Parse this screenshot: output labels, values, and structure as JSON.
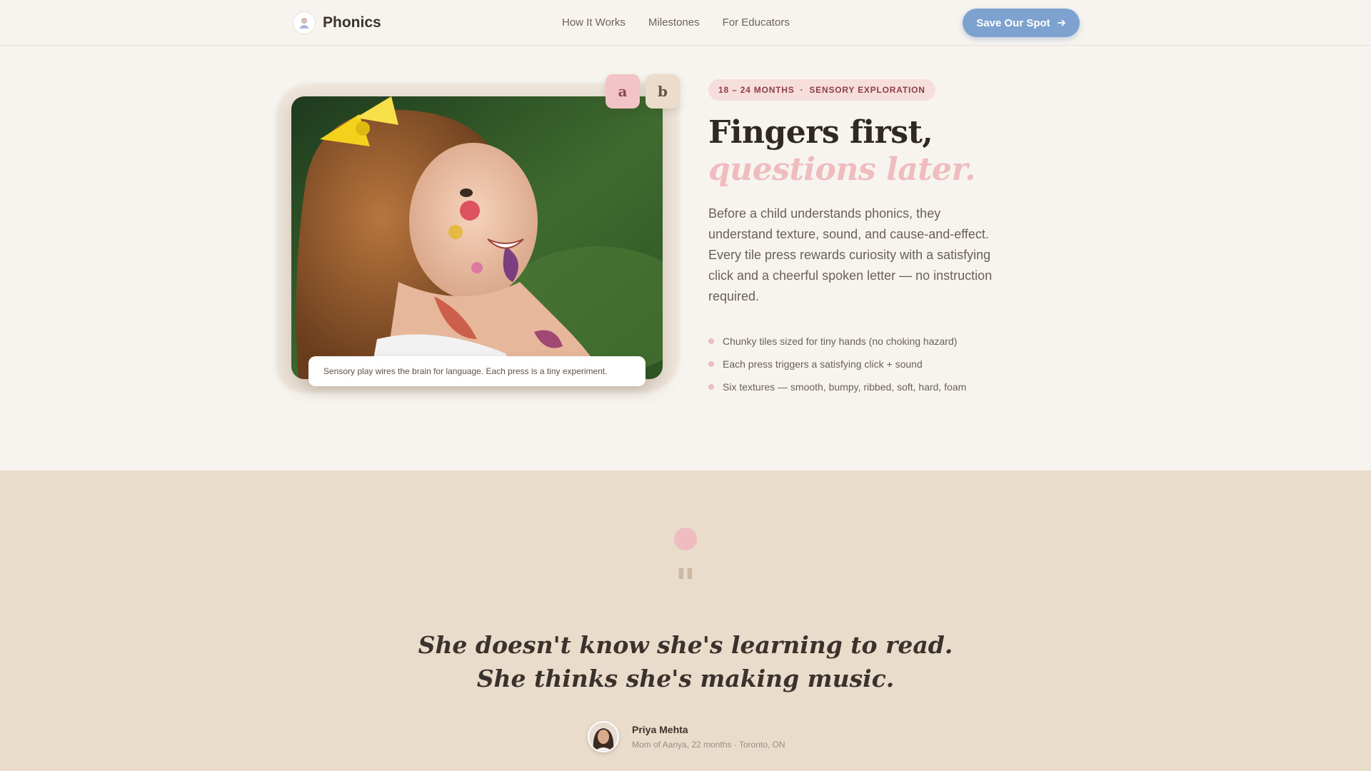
{
  "nav": {
    "brand": "Phonics",
    "links": [
      "How It Works",
      "Milestones",
      "For Educators"
    ],
    "cta_label": "Save Our Spot",
    "cta_icon": "arrow-right-icon"
  },
  "hero": {
    "tiles": [
      "a",
      "b"
    ],
    "caption": "Sensory play wires the brain for language. Each press is a tiny experiment.",
    "badge": {
      "age": "18 – 24 MONTHS",
      "separator": "·",
      "topic": "SENSORY EXPLORATION"
    },
    "headline_line1": "Fingers first,",
    "headline_line2": "questions later.",
    "intro": "Before a child understands phonics, they understand texture, sound, and cause-and-effect. Every tile press rewards curiosity with a satisfying click and a cheerful spoken letter — no instruction required.",
    "bullets": [
      "Chunky tiles sized for tiny hands (no choking hazard)",
      "Each press triggers a satisfying click + sound",
      "Six textures — smooth, bumpy, ribbed, soft, hard, foam"
    ]
  },
  "testimonial": {
    "quote_mark": "\"",
    "quote": "She doesn't know she's learning to read. She thinks she's making music.",
    "author_name": "Priya Mehta",
    "author_meta": "Mom of Aanya, 22 months · Toronto, ON"
  },
  "colors": {
    "background": "#f7f4ef",
    "accent_blue": "#7ea2cf",
    "accent_pink": "#efbcbf",
    "testimonial_bg": "#e9dccb"
  }
}
